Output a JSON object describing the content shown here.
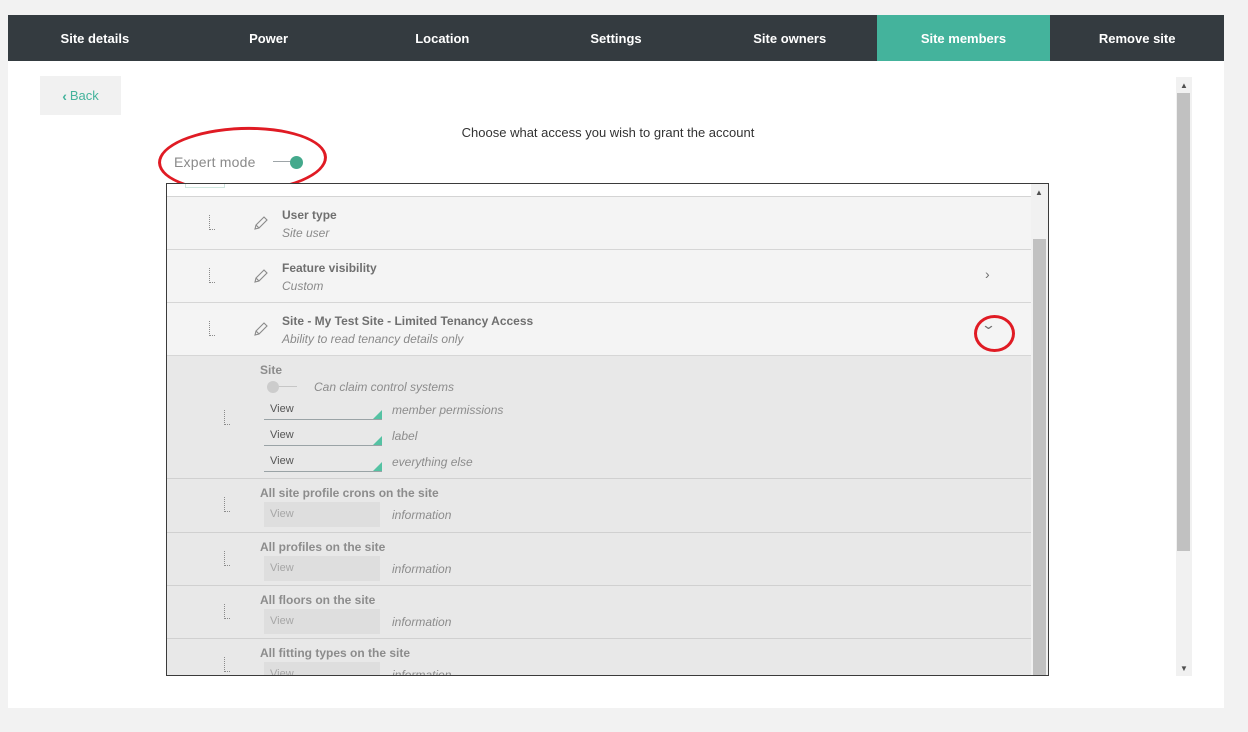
{
  "nav": {
    "tabs": [
      {
        "label": "Site details"
      },
      {
        "label": "Power"
      },
      {
        "label": "Location"
      },
      {
        "label": "Settings"
      },
      {
        "label": "Site owners"
      },
      {
        "label": "Site members",
        "active": true
      },
      {
        "label": "Remove site"
      }
    ]
  },
  "back": {
    "label": "Back",
    "icon": "chevron-left-icon"
  },
  "heading": "Choose what access you wish to grant the account",
  "expert_mode": {
    "label": "Expert mode",
    "enabled": true
  },
  "permissions": {
    "rows": [
      {
        "title": "User type",
        "subtitle": "Site user",
        "icon": "pencil-icon"
      },
      {
        "title": "Feature visibility",
        "subtitle": "Custom",
        "icon": "pencil-icon",
        "chevron": "chevron-right-icon"
      },
      {
        "title": "Site - My Test Site - Limited Tenancy Access",
        "subtitle": "Ability to read tenancy details only",
        "icon": "pencil-icon",
        "chevron": "chevron-down-icon"
      }
    ],
    "site": {
      "title": "Site",
      "claim_toggle_label": "Can claim control systems",
      "selects": [
        {
          "value": "View",
          "hint": "member permissions"
        },
        {
          "value": "View",
          "hint": "label"
        },
        {
          "value": "View",
          "hint": "everything else"
        }
      ]
    },
    "groups": [
      {
        "title": "All site profile crons on the site",
        "value": "View",
        "hint": "information"
      },
      {
        "title": "All profiles on the site",
        "value": "View",
        "hint": "information"
      },
      {
        "title": "All floors on the site",
        "value": "View",
        "hint": "information"
      },
      {
        "title": "All fitting types on the site",
        "value": "View",
        "hint": "information"
      }
    ]
  },
  "colors": {
    "nav_bg": "#343b40",
    "accent": "#44b39c",
    "annotation": "#e01b24"
  }
}
